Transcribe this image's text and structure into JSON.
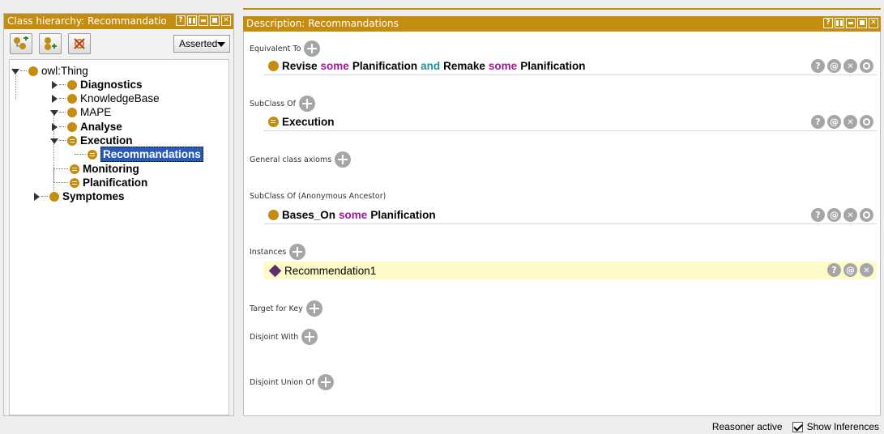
{
  "left_panel": {
    "title": "Class hierarchy: Recommandatio",
    "ctrl_help": "?",
    "toolbar": {
      "add_subclass_icon": "add-subclass-icon",
      "add_sibling_icon": "add-sibling-icon",
      "delete_icon": "delete-class-icon",
      "mode_select": "Asserted"
    },
    "tree": {
      "root": "owl:Thing",
      "diagnostics": "Diagnostics",
      "knowledgebase": "KnowledgeBase",
      "mape": "MAPE",
      "analyse": "Analyse",
      "execution": "Execution",
      "recommandations": "Recommandations",
      "monitoring": "Monitoring",
      "planification": "Planification",
      "symptomes": "Symptomes"
    }
  },
  "right_panel": {
    "title": "Description: Recommandations",
    "ctrl_help": "?",
    "sections": {
      "equivalent_to": "Equivalent To",
      "subclass_of": "SubClass Of",
      "general_axioms": "General class axioms",
      "anon_ancestor": "SubClass Of (Anonymous Ancestor)",
      "instances": "Instances",
      "target_for_key": "Target for Key",
      "disjoint_with": "Disjoint With",
      "disjoint_union": "Disjoint Union Of"
    },
    "equivalent_row": {
      "t1": "Revise",
      "k1": "some",
      "t2": "Planification",
      "k2": "and",
      "t3": "Remake",
      "k3": "some",
      "t4": "Planification"
    },
    "subclass_row": {
      "t1": "Execution"
    },
    "ancestor_row": {
      "t1": "Bases_On",
      "k1": "some",
      "t2": "Planification"
    },
    "instance_row": {
      "t1": "Recommendation1"
    },
    "actions": {
      "help": "?",
      "annotate": "@"
    },
    "colors": {
      "header": "#c48d10",
      "keyword_some": "#a0169e",
      "keyword_and": "#1c8d9c",
      "highlight": "#fffbc9"
    }
  },
  "status_bar": {
    "reasoner": "Reasoner active",
    "show_inferences": "Show Inferences"
  }
}
